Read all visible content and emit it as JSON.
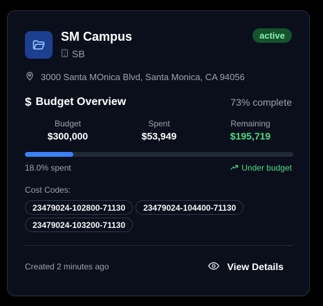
{
  "project": {
    "name": "SM Campus",
    "code": "SB",
    "status": "active",
    "address": "3000 Santa MOnica Blvd, Santa Monica, CA 94056"
  },
  "budget": {
    "heading": "Budget Overview",
    "complete_text": "73% complete",
    "budget_label": "Budget",
    "budget_value": "$300,000",
    "spent_label": "Spent",
    "spent_value": "$53,949",
    "remaining_label": "Remaining",
    "remaining_value": "$195,719",
    "spent_fraction": 0.18,
    "spent_text": "18.0% spent",
    "trend_text": "Under budget"
  },
  "cost_codes": {
    "label": "Cost Codes:",
    "items": [
      "23479024-102800-71130",
      "23479024-104400-71130",
      "23479024-103200-71130"
    ]
  },
  "footer": {
    "created_text": "Created 2 minutes ago",
    "view_details_label": "View Details"
  },
  "icons": {
    "project": "folder-open-icon",
    "code": "building-icon",
    "address": "map-pin-icon",
    "budget": "dollar-icon",
    "trend": "trending-up-icon",
    "view": "eye-icon"
  },
  "colors": {
    "accent": "#3b82f6",
    "status_bg": "#14532d",
    "status_text": "#86efac",
    "positive": "#4ade80"
  }
}
